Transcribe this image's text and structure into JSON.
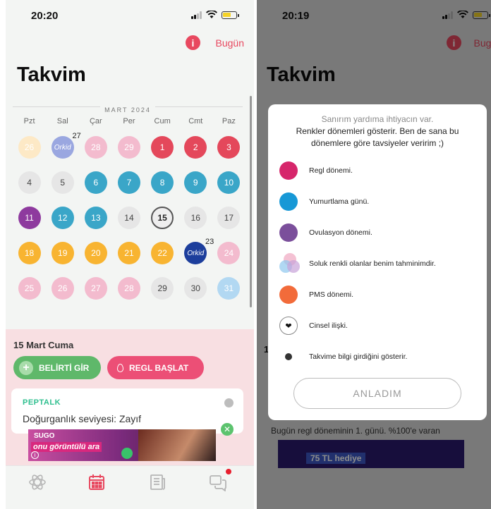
{
  "left": {
    "status_time": "20:20",
    "header": {
      "info_label": "i",
      "today_label": "Bugün",
      "title": "Takvim"
    },
    "month_label": "MART 2024",
    "weekdays": [
      "Pzt",
      "Sal",
      "Çar",
      "Per",
      "Cum",
      "Cmt",
      "Paz"
    ],
    "days": [
      {
        "label": "26",
        "type": "pale"
      },
      {
        "label": "Orkid",
        "type": "orkidpale",
        "sup": "27"
      },
      {
        "label": "28",
        "type": "pred"
      },
      {
        "label": "29",
        "type": "pred"
      },
      {
        "label": "1",
        "type": "period"
      },
      {
        "label": "2",
        "type": "period"
      },
      {
        "label": "3",
        "type": "period"
      },
      {
        "label": "4",
        "type": "normal"
      },
      {
        "label": "5",
        "type": "normal"
      },
      {
        "label": "6",
        "type": "ovul"
      },
      {
        "label": "7",
        "type": "ovul"
      },
      {
        "label": "8",
        "type": "ovul"
      },
      {
        "label": "9",
        "type": "ovul"
      },
      {
        "label": "10",
        "type": "ovul"
      },
      {
        "label": "11",
        "type": "ovdays"
      },
      {
        "label": "12",
        "type": "ovul"
      },
      {
        "label": "13",
        "type": "ovul"
      },
      {
        "label": "14",
        "type": "normal"
      },
      {
        "label": "15",
        "type": "today"
      },
      {
        "label": "16",
        "type": "normal"
      },
      {
        "label": "17",
        "type": "normal"
      },
      {
        "label": "18",
        "type": "pms"
      },
      {
        "label": "19",
        "type": "pms"
      },
      {
        "label": "20",
        "type": "pms"
      },
      {
        "label": "21",
        "type": "pms"
      },
      {
        "label": "22",
        "type": "pms"
      },
      {
        "label": "Orkid",
        "type": "orkid",
        "sup": "23"
      },
      {
        "label": "24",
        "type": "pred"
      },
      {
        "label": "25",
        "type": "pred"
      },
      {
        "label": "26",
        "type": "pred"
      },
      {
        "label": "27",
        "type": "pred"
      },
      {
        "label": "28",
        "type": "pred"
      },
      {
        "label": "29",
        "type": "normal"
      },
      {
        "label": "30",
        "type": "normal"
      },
      {
        "label": "31",
        "type": "predb"
      }
    ],
    "selected_date": "15 Mart Cuma",
    "symptom_button": "BELİRTİ GİR",
    "period_button": "REGL BAŞLAT",
    "card": {
      "tag": "PEPTALK",
      "text": "Doğurganlık seviyesi: Zayıf"
    },
    "ad": {
      "brand": "SUGO",
      "text": "onu görüntülü ara",
      "info": "i"
    },
    "tabs": [
      "atom-icon",
      "calendar-icon",
      "news-icon",
      "chat-icon"
    ]
  },
  "right": {
    "status_time": "20:19",
    "today_label": "Bugün",
    "title": "Takvim",
    "modal": {
      "title": "Sanırım yardıma ihtiyacın var.",
      "intro": "Renkler dönemleri gösterir. Ben de sana bu dönemlere göre tavsiyeler veririm ;)",
      "legend": [
        {
          "label": "Regl dönemi.",
          "color": "#d6266b"
        },
        {
          "label": "Yumurtlama günü.",
          "color": "#1798d6"
        },
        {
          "label": "Ovulasyon dönemi.",
          "color": "#7b4f9b"
        },
        {
          "label": "Soluk renkli olanlar benim tahminimdir.",
          "color": "overlap"
        },
        {
          "label": "PMS dönemi.",
          "color": "#f26b3a"
        },
        {
          "label": "Cinsel ilişki.",
          "color": "heart"
        },
        {
          "label": "Takvime bilgi girdiğini gösterir.",
          "color": "dot"
        }
      ],
      "ok_button": "ANLADIM"
    },
    "behind_text": "Bugün regl döneminin 1. günü. %100'e varan",
    "behind_ad": "75 TL hediye",
    "behind_number": "1"
  }
}
